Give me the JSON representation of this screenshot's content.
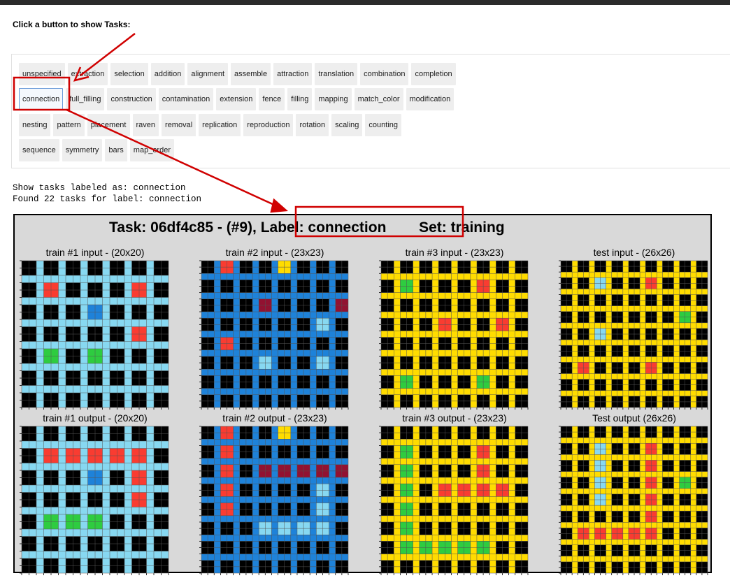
{
  "prompt": "Click a button to show Tasks:",
  "buttons": [
    [
      "unspecified",
      "extraction",
      "selection",
      "addition",
      "alignment",
      "assemble",
      "attraction",
      "translation",
      "combination",
      "completion"
    ],
    [
      "connection",
      "full_filling",
      "construction",
      "contamination",
      "extension",
      "fence",
      "filling",
      "mapping",
      "match_color",
      "modification"
    ],
    [
      "nesting",
      "pattern",
      "placement",
      "raven",
      "removal",
      "replication",
      "reproduction",
      "rotation",
      "scaling",
      "counting"
    ],
    [
      "sequence",
      "symmetry",
      "bars",
      "map_order"
    ]
  ],
  "active_button": "connection",
  "output_lines": [
    "Show tasks labeled as: connection",
    "Found 22 tasks for label: connection"
  ],
  "figure": {
    "title_task": "Task: 06df4c85 - (#9),",
    "title_label": "Label: connection",
    "title_set": "Set: training"
  },
  "colors": {
    "black": "#000000",
    "sky": "#87d8f1",
    "blue": "#1e82d9",
    "red": "#f93c31",
    "green": "#2ecc40",
    "yellow": "#ffdc00",
    "maroon": "#921231",
    "panel": "#d9d9d9",
    "annotation": "#d00000"
  },
  "grids": [
    {
      "label": "train #1 input  - (20x20)",
      "size": 20,
      "line": "sky",
      "cells": [
        [
          1,
          1,
          "red"
        ],
        [
          1,
          5,
          "red"
        ],
        [
          2,
          3,
          "blue"
        ],
        [
          3,
          5,
          "red"
        ],
        [
          4,
          1,
          "green"
        ],
        [
          4,
          3,
          "green"
        ]
      ]
    },
    {
      "label": "train #2 input  - (23x23)",
      "size": 23,
      "line": "blue",
      "cells": [
        [
          0,
          1,
          "red"
        ],
        [
          0,
          4,
          "yellow"
        ],
        [
          2,
          3,
          "maroon"
        ],
        [
          2,
          7,
          "maroon"
        ],
        [
          3,
          6,
          "sky"
        ],
        [
          4,
          1,
          "red"
        ],
        [
          5,
          3,
          "sky"
        ],
        [
          5,
          6,
          "sky"
        ]
      ]
    },
    {
      "label": "train #3 input  - (23x23)",
      "size": 23,
      "line": "yellow",
      "cells": [
        [
          1,
          1,
          "green"
        ],
        [
          1,
          5,
          "red"
        ],
        [
          3,
          3,
          "red"
        ],
        [
          3,
          6,
          "red"
        ],
        [
          6,
          1,
          "green"
        ],
        [
          6,
          5,
          "green"
        ]
      ]
    },
    {
      "label": "test input  - (26x26)",
      "size": 26,
      "line": "yellow",
      "cells": [
        [
          1,
          2,
          "sky"
        ],
        [
          1,
          5,
          "red"
        ],
        [
          3,
          7,
          "green"
        ],
        [
          4,
          2,
          "sky"
        ],
        [
          6,
          1,
          "red"
        ],
        [
          6,
          5,
          "red"
        ]
      ]
    },
    {
      "label": "train #1 output  - (20x20)",
      "size": 20,
      "line": "sky",
      "cells": [
        [
          1,
          1,
          "red"
        ],
        [
          1,
          2,
          "red"
        ],
        [
          1,
          3,
          "red"
        ],
        [
          1,
          4,
          "red"
        ],
        [
          1,
          5,
          "red"
        ],
        [
          2,
          3,
          "blue"
        ],
        [
          2,
          5,
          "red"
        ],
        [
          3,
          5,
          "red"
        ],
        [
          4,
          1,
          "green"
        ],
        [
          4,
          2,
          "green"
        ],
        [
          4,
          3,
          "green"
        ]
      ]
    },
    {
      "label": "train #2 output  - (23x23)",
      "size": 23,
      "line": "blue",
      "cells": [
        [
          0,
          1,
          "red"
        ],
        [
          0,
          4,
          "yellow"
        ],
        [
          1,
          1,
          "red"
        ],
        [
          2,
          1,
          "red"
        ],
        [
          2,
          3,
          "maroon"
        ],
        [
          2,
          4,
          "maroon"
        ],
        [
          2,
          5,
          "maroon"
        ],
        [
          2,
          6,
          "maroon"
        ],
        [
          2,
          7,
          "maroon"
        ],
        [
          3,
          1,
          "red"
        ],
        [
          3,
          6,
          "sky"
        ],
        [
          4,
          1,
          "red"
        ],
        [
          4,
          6,
          "sky"
        ],
        [
          5,
          3,
          "sky"
        ],
        [
          5,
          4,
          "sky"
        ],
        [
          5,
          5,
          "sky"
        ],
        [
          5,
          6,
          "sky"
        ]
      ]
    },
    {
      "label": "train #3 output  - (23x23)",
      "size": 23,
      "line": "yellow",
      "cells": [
        [
          1,
          1,
          "green"
        ],
        [
          1,
          5,
          "red"
        ],
        [
          2,
          1,
          "green"
        ],
        [
          2,
          5,
          "red"
        ],
        [
          3,
          1,
          "green"
        ],
        [
          3,
          3,
          "red"
        ],
        [
          3,
          4,
          "red"
        ],
        [
          3,
          5,
          "red"
        ],
        [
          3,
          6,
          "red"
        ],
        [
          4,
          1,
          "green"
        ],
        [
          5,
          1,
          "green"
        ],
        [
          6,
          1,
          "green"
        ],
        [
          6,
          2,
          "green"
        ],
        [
          6,
          3,
          "green"
        ],
        [
          6,
          4,
          "green"
        ],
        [
          6,
          5,
          "green"
        ]
      ]
    },
    {
      "label": "Test output (26x26)",
      "size": 26,
      "line": "yellow",
      "cells": [
        [
          1,
          2,
          "sky"
        ],
        [
          1,
          5,
          "red"
        ],
        [
          2,
          2,
          "sky"
        ],
        [
          2,
          5,
          "red"
        ],
        [
          3,
          2,
          "sky"
        ],
        [
          3,
          5,
          "red"
        ],
        [
          3,
          7,
          "green"
        ],
        [
          4,
          2,
          "sky"
        ],
        [
          4,
          5,
          "red"
        ],
        [
          5,
          5,
          "red"
        ],
        [
          6,
          1,
          "red"
        ],
        [
          6,
          2,
          "red"
        ],
        [
          6,
          3,
          "red"
        ],
        [
          6,
          4,
          "red"
        ],
        [
          6,
          5,
          "red"
        ]
      ]
    }
  ]
}
